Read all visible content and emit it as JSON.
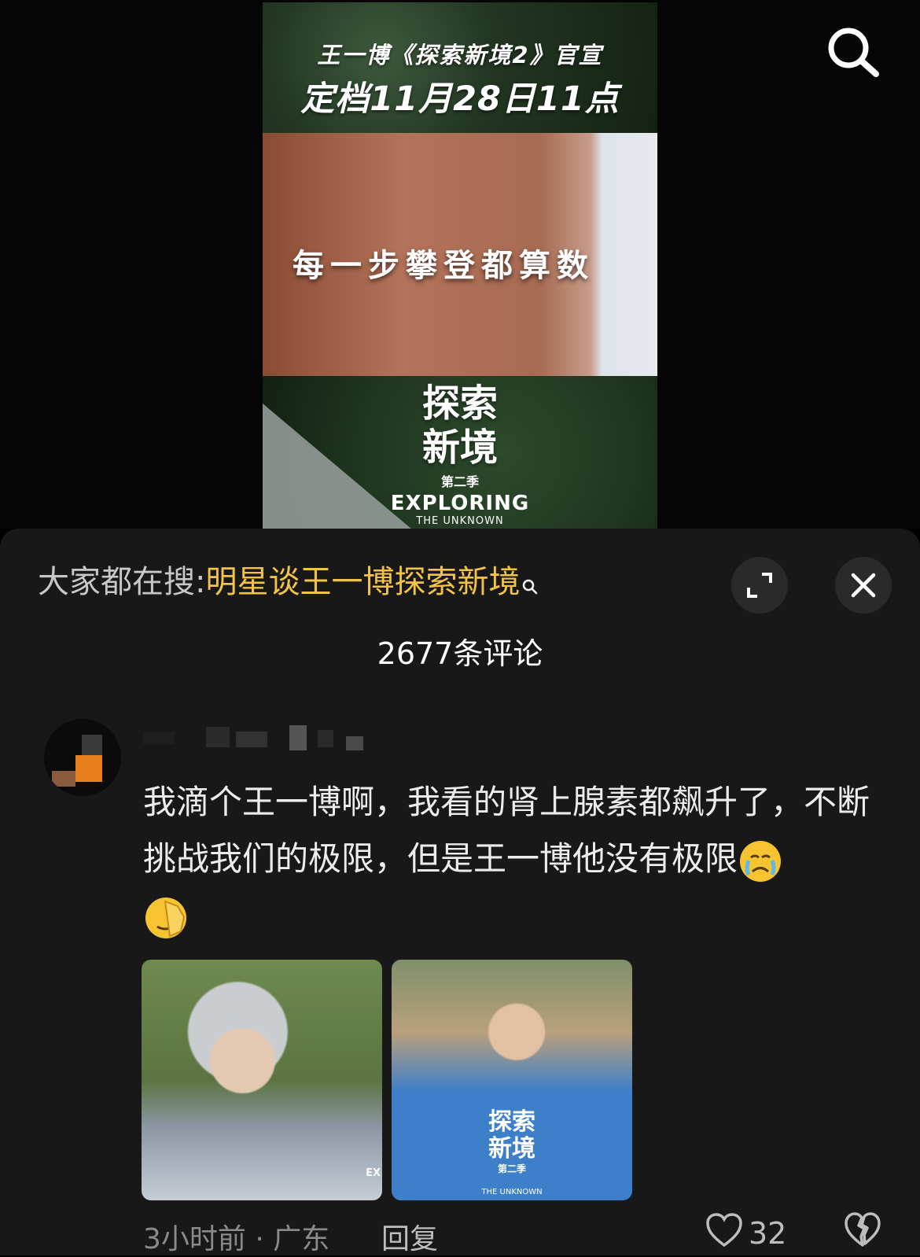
{
  "video": {
    "poster_line1": "王一博《探索新境2》官宣",
    "poster_line2": "定档11月28日11点",
    "poster_slogan": "每一步攀登都算数",
    "logo_cn_line1": "探索",
    "logo_cn_line2": "新境",
    "logo_season": "第二季",
    "logo_en": "EXPLORING",
    "logo_en_sub": "THE UNKNOWN"
  },
  "header": {
    "hot_search_prefix": "大家都在搜:",
    "hot_search_term": "明星谈王一博探索新境",
    "comment_count": "2677条评论"
  },
  "comment": {
    "text_main": "我滴个王一博啊，我看的肾上腺素都飙升了，不断挑战我们的极限，但是王一博他没有极限",
    "photo_2_logo_line1": "探索",
    "photo_2_logo_line2": "新境",
    "photo_2_season": "第二季",
    "photo_2_sub": "THE UNKNOWN",
    "photo_1_mark": "EX",
    "time_location": "3小时前 · 广东",
    "reply_label": "回复",
    "like_count": "32"
  },
  "icons": [
    "search-icon",
    "expand-icon",
    "close-icon",
    "crying-emoji-icon",
    "facepalm-emoji-icon",
    "heart-icon",
    "broken-heart-icon"
  ],
  "colors": {
    "accent": "#f2c24a",
    "sheet_bg": "#181818",
    "muted_text": "#8a8a8a"
  }
}
